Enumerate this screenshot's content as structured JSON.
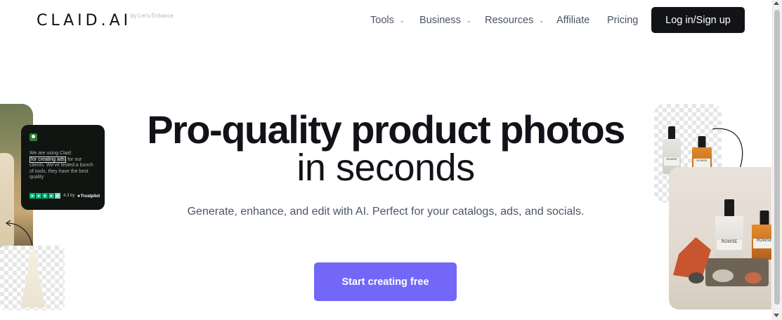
{
  "brand": {
    "logo": "CLAID.AI",
    "tagline": "by Let's Enhance"
  },
  "nav": {
    "items": [
      {
        "label": "Tools",
        "has_dropdown": true
      },
      {
        "label": "Business",
        "has_dropdown": true
      },
      {
        "label": "Resources",
        "has_dropdown": true
      },
      {
        "label": "Affiliate",
        "has_dropdown": false
      },
      {
        "label": "Pricing",
        "has_dropdown": false
      }
    ],
    "chevron": "⌄",
    "login_label": "Log in/Sign up"
  },
  "hero": {
    "title_line1": "Pro-quality product photos",
    "title_line2": "in seconds",
    "subtitle": "Generate, enhance, and edit with AI. Perfect for your catalogs, ads, and socials.",
    "cta_label": "Start creating free"
  },
  "review": {
    "text_before": "We are using Claid",
    "highlight": "for creating ads",
    "text_after": "for our clients. We've tested a bunch of tools, they have the best quality",
    "rating": "4.3 by",
    "source": "Trustpilot",
    "stars": 5
  },
  "product": {
    "brand_label": "ROWSE"
  },
  "colors": {
    "primary_cta": "#7367f8",
    "login_bg": "#121317",
    "text_dark": "#111318",
    "text_muted": "#4b5566",
    "trustpilot_green": "#00b67a"
  }
}
